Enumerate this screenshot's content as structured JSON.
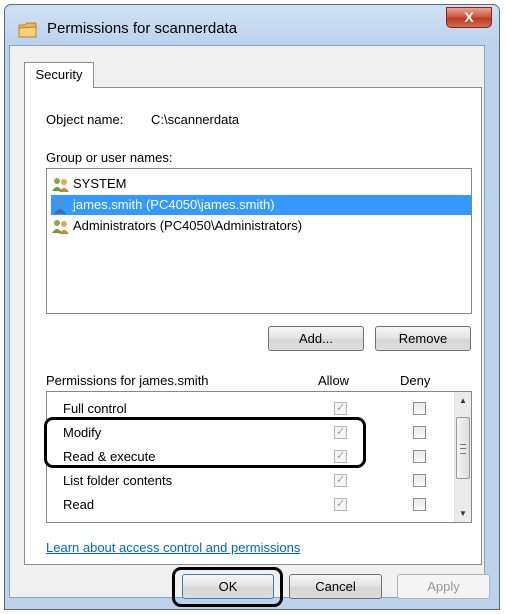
{
  "window": {
    "title": "Permissions for scannerdata",
    "close_label": "X"
  },
  "tabs": [
    {
      "label": "Security"
    }
  ],
  "object": {
    "label": "Object name:",
    "value": "C:\\scannerdata"
  },
  "group_users": {
    "label": "Group or user names:",
    "users": [
      {
        "name": "SYSTEM",
        "icon": "group-users-icon",
        "selected": false
      },
      {
        "name": "james.smith (PC4050\\james.smith)",
        "icon": "user-icon",
        "selected": true
      },
      {
        "name": "Administrators (PC4050\\Administrators)",
        "icon": "group-users-icon",
        "selected": false
      }
    ],
    "add_label": "Add...",
    "remove_label": "Remove"
  },
  "permissions": {
    "header_label": "Permissions for james.smith",
    "allow_label": "Allow",
    "deny_label": "Deny",
    "items": [
      {
        "name": "Full control",
        "allow": true,
        "deny": false
      },
      {
        "name": "Modify",
        "allow": true,
        "deny": false
      },
      {
        "name": "Read & execute",
        "allow": true,
        "deny": false
      },
      {
        "name": "List folder contents",
        "allow": true,
        "deny": false
      },
      {
        "name": "Read",
        "allow": true,
        "deny": false
      }
    ]
  },
  "link_text": "Learn about access control and permissions",
  "buttons": {
    "ok": "OK",
    "cancel": "Cancel",
    "apply": "Apply"
  },
  "colors": {
    "selection": "#3399ff",
    "link": "#0066cc",
    "titlebar": "#bcd3ee",
    "close": "#c0391f"
  }
}
